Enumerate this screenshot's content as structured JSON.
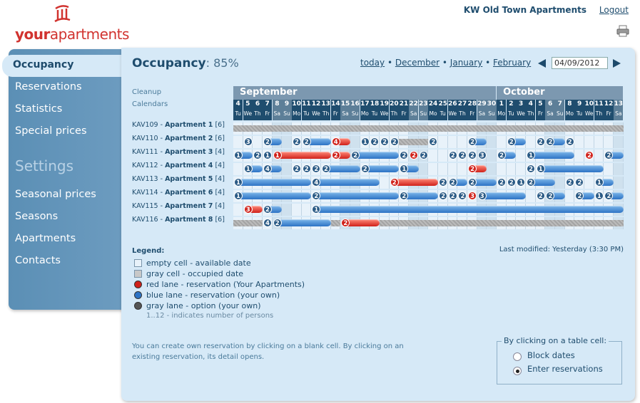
{
  "header": {
    "logo_text_bold": "your",
    "logo_text_rest": "apartments",
    "site_name": "KW Old Town Apartments",
    "logout": "Logout"
  },
  "sidebar": {
    "items": [
      {
        "label": "Occupancy"
      },
      {
        "label": "Reservations"
      },
      {
        "label": "Statistics"
      },
      {
        "label": "Special prices"
      }
    ],
    "settings_heading": "Settings",
    "settings_items": [
      {
        "label": "Seasonal prices"
      },
      {
        "label": "Seasons"
      },
      {
        "label": "Apartments"
      },
      {
        "label": "Contacts"
      }
    ]
  },
  "main": {
    "title": "Occupancy",
    "occupancy_pct": ": 85%",
    "nav": {
      "today": "today",
      "m1": "December",
      "m2": "January",
      "m3": "February",
      "sep": " • "
    },
    "date_value": "04/09/2012",
    "cleanup": "Cleanup",
    "calendars": "Calendars",
    "months": [
      {
        "label": "September"
      },
      {
        "label": "October"
      }
    ],
    "days": [
      {
        "d": "4",
        "w": "Tu"
      },
      {
        "d": "5",
        "w": "We"
      },
      {
        "d": "6",
        "w": "Th"
      },
      {
        "d": "7",
        "w": "Fr"
      },
      {
        "d": "8",
        "w": "Sa"
      },
      {
        "d": "9",
        "w": "Su"
      },
      {
        "d": "10",
        "w": "Mo"
      },
      {
        "d": "11",
        "w": "Tu"
      },
      {
        "d": "12",
        "w": "We"
      },
      {
        "d": "13",
        "w": "Th"
      },
      {
        "d": "14",
        "w": "Fr"
      },
      {
        "d": "15",
        "w": "Sa"
      },
      {
        "d": "16",
        "w": "Su"
      },
      {
        "d": "17",
        "w": "Mo"
      },
      {
        "d": "18",
        "w": "Tu"
      },
      {
        "d": "19",
        "w": "We"
      },
      {
        "d": "20",
        "w": "Th"
      },
      {
        "d": "21",
        "w": "Fr"
      },
      {
        "d": "22",
        "w": "Sa"
      },
      {
        "d": "23",
        "w": "Su"
      },
      {
        "d": "24",
        "w": "Mo"
      },
      {
        "d": "25",
        "w": "Tu"
      },
      {
        "d": "26",
        "w": "We"
      },
      {
        "d": "27",
        "w": "Th"
      },
      {
        "d": "28",
        "w": "Fr"
      },
      {
        "d": "29",
        "w": "Sa"
      },
      {
        "d": "30",
        "w": "Su"
      },
      {
        "d": "1",
        "w": "Mo"
      },
      {
        "d": "2",
        "w": "Tu"
      },
      {
        "d": "3",
        "w": "We"
      },
      {
        "d": "4",
        "w": "Th"
      },
      {
        "d": "5",
        "w": "Fr"
      },
      {
        "d": "6",
        "w": "Sa"
      },
      {
        "d": "7",
        "w": "Su"
      },
      {
        "d": "8",
        "w": "Mo"
      },
      {
        "d": "9",
        "w": "Tu"
      },
      {
        "d": "10",
        "w": "We"
      },
      {
        "d": "11",
        "w": "Th"
      },
      {
        "d": "12",
        "w": "Fr"
      },
      {
        "d": "13",
        "w": "Sa"
      }
    ],
    "apartments": [
      {
        "code": "KAV109 - ",
        "name": "Apartment 1",
        "cap": " [6]"
      },
      {
        "code": "KAV110 - ",
        "name": "Apartment 2",
        "cap": " [6]"
      },
      {
        "code": "KAV111 - ",
        "name": "Apartment 3",
        "cap": " [4]"
      },
      {
        "code": "KAV112 - ",
        "name": "Apartment 4",
        "cap": " [4]"
      },
      {
        "code": "KAV113 - ",
        "name": "Apartment 5",
        "cap": " [4]"
      },
      {
        "code": "KAV114 - ",
        "name": "Apartment 6",
        "cap": " [4]"
      },
      {
        "code": "KAV115 - ",
        "name": "Apartment 7",
        "cap": " [4]"
      },
      {
        "code": "KAV116 - ",
        "name": "Apartment 8",
        "cap": " [6]"
      }
    ],
    "reservations": [
      [
        {
          "s": 0,
          "e": 40,
          "t": "occ"
        }
      ],
      [
        {
          "s": 1,
          "e": 2,
          "t": "b",
          "n": "3"
        },
        {
          "s": 3,
          "e": 5,
          "t": "b",
          "n": "2"
        },
        {
          "s": 6,
          "e": 7,
          "t": "b",
          "n": "2"
        },
        {
          "s": 7,
          "e": 10,
          "t": "b",
          "n": "2"
        },
        {
          "s": 10,
          "e": 12,
          "t": "r",
          "n": "4"
        },
        {
          "s": 13,
          "e": 14,
          "t": "b",
          "n": "1"
        },
        {
          "s": 14,
          "e": 15,
          "t": "b",
          "n": "2"
        },
        {
          "s": 15,
          "e": 16,
          "t": "b",
          "n": "2"
        },
        {
          "s": 16,
          "e": 17,
          "t": "b",
          "n": "2"
        },
        {
          "s": 17,
          "e": 20,
          "t": "occ"
        },
        {
          "s": 20,
          "e": 21,
          "t": "b",
          "n": "2"
        },
        {
          "s": 24,
          "e": 26,
          "t": "b",
          "n": "2"
        },
        {
          "s": 28,
          "e": 30,
          "t": "b",
          "n": "2"
        },
        {
          "s": 31,
          "e": 32,
          "t": "b",
          "n": "2"
        },
        {
          "s": 32,
          "e": 34,
          "t": "b",
          "n": "2"
        },
        {
          "s": 34,
          "e": 35,
          "t": "b",
          "n": "2"
        }
      ],
      [
        {
          "s": 0,
          "e": 2,
          "t": "b",
          "n": "1"
        },
        {
          "s": 2,
          "e": 3,
          "t": "b",
          "n": "2"
        },
        {
          "s": 3,
          "e": 4,
          "t": "b",
          "n": "1"
        },
        {
          "s": 4,
          "e": 10,
          "t": "r",
          "n": "1"
        },
        {
          "s": 10,
          "e": 12,
          "t": "r",
          "n": "2"
        },
        {
          "s": 12,
          "e": 17,
          "t": "b",
          "n": "2"
        },
        {
          "s": 17,
          "e": 18,
          "t": "b",
          "n": "2"
        },
        {
          "s": 18,
          "e": 19,
          "t": "r",
          "n": "2"
        },
        {
          "s": 19,
          "e": 20,
          "t": "b",
          "n": "2"
        },
        {
          "s": 22,
          "e": 23,
          "t": "b",
          "n": "2"
        },
        {
          "s": 23,
          "e": 24,
          "t": "b",
          "n": "2"
        },
        {
          "s": 24,
          "e": 25,
          "t": "b",
          "n": "2"
        },
        {
          "s": 25,
          "e": 26,
          "t": "b",
          "n": "3"
        },
        {
          "s": 27,
          "e": 29,
          "t": "b",
          "n": "2"
        },
        {
          "s": 30,
          "e": 35,
          "t": "b",
          "n": "1"
        },
        {
          "s": 36,
          "e": 37,
          "t": "r",
          "n": "2"
        },
        {
          "s": 38,
          "e": 40,
          "t": "b",
          "n": "2"
        }
      ],
      [
        {
          "s": 1,
          "e": 3,
          "t": "b",
          "n": "1"
        },
        {
          "s": 3,
          "e": 5,
          "t": "b",
          "n": "4"
        },
        {
          "s": 6,
          "e": 7,
          "t": "b",
          "n": "2"
        },
        {
          "s": 7,
          "e": 8,
          "t": "b",
          "n": "2"
        },
        {
          "s": 8,
          "e": 9,
          "t": "b",
          "n": "2"
        },
        {
          "s": 9,
          "e": 13,
          "t": "b",
          "n": "2"
        },
        {
          "s": 13,
          "e": 17,
          "t": "b",
          "n": "2"
        },
        {
          "s": 17,
          "e": 19,
          "t": "b",
          "n": "1"
        },
        {
          "s": 24,
          "e": 26,
          "t": "r",
          "n": "2"
        },
        {
          "s": 30,
          "e": 31,
          "t": "b",
          "n": "2"
        },
        {
          "s": 31,
          "e": 38,
          "t": "b",
          "n": "1"
        }
      ],
      [
        {
          "s": 0,
          "e": 8,
          "t": "b",
          "n": "1"
        },
        {
          "s": 8,
          "e": 15,
          "t": "b",
          "n": "4"
        },
        {
          "s": 16,
          "e": 21,
          "t": "r",
          "n": "2"
        },
        {
          "s": 21,
          "e": 22,
          "t": "b",
          "n": "2"
        },
        {
          "s": 22,
          "e": 24,
          "t": "b",
          "n": "2"
        },
        {
          "s": 24,
          "e": 27,
          "t": "b",
          "n": "2"
        },
        {
          "s": 27,
          "e": 28,
          "t": "b",
          "n": "2"
        },
        {
          "s": 28,
          "e": 29,
          "t": "b",
          "n": "2"
        },
        {
          "s": 29,
          "e": 30,
          "t": "b",
          "n": "1"
        },
        {
          "s": 30,
          "e": 33,
          "t": "b",
          "n": "2"
        },
        {
          "s": 34,
          "e": 35,
          "t": "b",
          "n": "2"
        },
        {
          "s": 35,
          "e": 36,
          "t": "b",
          "n": "2"
        },
        {
          "s": 37,
          "e": 39,
          "t": "b",
          "n": "1"
        }
      ],
      [
        {
          "s": 0,
          "e": 8,
          "t": "b",
          "n": "1"
        },
        {
          "s": 8,
          "e": 17,
          "t": "b",
          "n": "2"
        },
        {
          "s": 17,
          "e": 21,
          "t": "b",
          "n": "2"
        },
        {
          "s": 21,
          "e": 22,
          "t": "b",
          "n": "2"
        },
        {
          "s": 22,
          "e": 23,
          "t": "b",
          "n": "2"
        },
        {
          "s": 23,
          "e": 24,
          "t": "b",
          "n": "2"
        },
        {
          "s": 24,
          "e": 25,
          "t": "r",
          "n": "3"
        },
        {
          "s": 25,
          "e": 30,
          "t": "b",
          "n": "3"
        },
        {
          "s": 31,
          "e": 32,
          "t": "b",
          "n": "2"
        },
        {
          "s": 32,
          "e": 34,
          "t": "b",
          "n": "2"
        },
        {
          "s": 35,
          "e": 37,
          "t": "b",
          "n": "2"
        },
        {
          "s": 37,
          "e": 38,
          "t": "b",
          "n": "1"
        },
        {
          "s": 38,
          "e": 40,
          "t": "b",
          "n": "2"
        }
      ],
      [
        {
          "s": 1,
          "e": 3,
          "t": "r",
          "n": "3"
        },
        {
          "s": 3,
          "e": 5,
          "t": "b",
          "n": "2"
        },
        {
          "s": 8,
          "e": 40,
          "t": "b",
          "n": "1"
        }
      ],
      [
        {
          "s": 0,
          "e": 3,
          "t": "occ"
        },
        {
          "s": 3,
          "e": 4,
          "t": "b",
          "n": "4"
        },
        {
          "s": 4,
          "e": 10,
          "t": "b",
          "n": "2"
        },
        {
          "s": 10,
          "e": 11,
          "t": "occ"
        },
        {
          "s": 11,
          "e": 15,
          "t": "r",
          "n": "2"
        },
        {
          "s": 15,
          "e": 40,
          "t": "occ"
        }
      ]
    ],
    "legend": {
      "title": "Legend:",
      "items": [
        {
          "text": "empty cell - available date",
          "color": "#e8f2fa",
          "kind": "square"
        },
        {
          "text": "gray cell - occupied date",
          "color": "#c8c8c8",
          "kind": "square"
        },
        {
          "text": "red lane - reservation (Your Apartments)",
          "color": "#d0211a",
          "kind": "dot"
        },
        {
          "text": "blue lane - reservation (your own)",
          "color": "#2d73c5",
          "kind": "dot"
        },
        {
          "text": "gray lane - option (your own)",
          "color": "#555555",
          "kind": "dot"
        }
      ],
      "persons_note": "1..12 - indicates number of persons"
    },
    "last_modified": "Last modified: Yesterday (3:30 PM)",
    "help_text": "You can create own reservation by clicking on a blank cell. By clicking on an existing reservation, its detail opens.",
    "click_box": {
      "legend": "By clicking on a table cell:",
      "options": [
        {
          "label": "Block dates",
          "checked": false
        },
        {
          "label": "Enter reservations",
          "checked": true
        }
      ]
    }
  }
}
